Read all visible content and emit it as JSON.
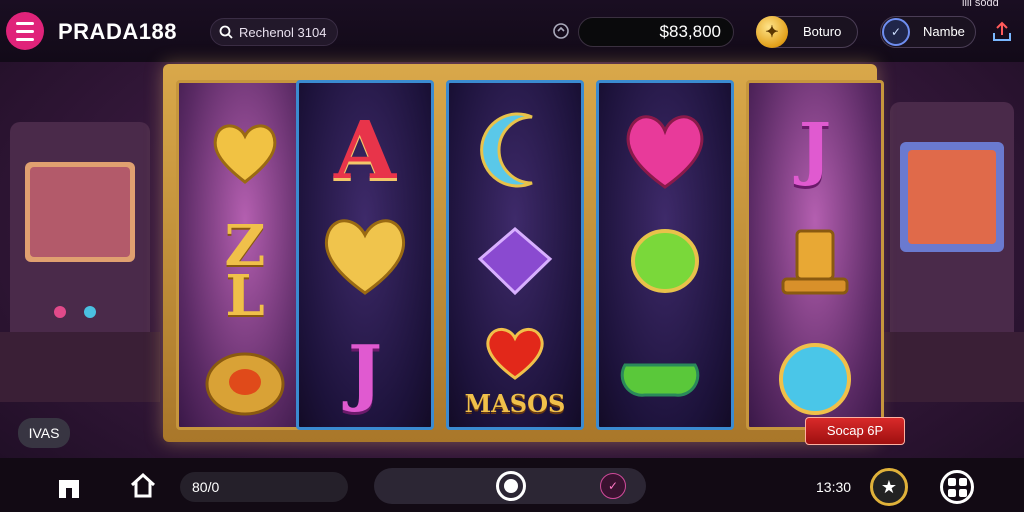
{
  "header": {
    "brand": "PRADA188",
    "search_text": "Rechenol 3104",
    "balance": "$83,800",
    "bonus_label": "Boturo",
    "mode_label": "Nambe",
    "corner_text": "ilil sodd",
    "icons": [
      "menu-icon",
      "search-icon",
      "wallet-icon",
      "coin-icon",
      "mode-icon",
      "share-icon"
    ]
  },
  "reels": [
    {
      "style": "gold",
      "symbols": [
        "gold-heart",
        "Z",
        "L",
        "ruby-ring"
      ]
    },
    {
      "style": "dark",
      "symbols": [
        "A",
        "gold-heart",
        "J"
      ]
    },
    {
      "style": "dark",
      "symbols": [
        "moon",
        "purple-pot",
        "heart",
        "MASOS"
      ]
    },
    {
      "style": "dark",
      "symbols": [
        "pink-heart",
        "green-gem",
        "green-teacup"
      ]
    },
    {
      "style": "gold",
      "symbols": [
        "J",
        "golden-hat",
        "blue-diamond"
      ]
    }
  ],
  "reel_letters": {
    "A": "A",
    "J": "J",
    "Z": "Z",
    "L": "L",
    "J2": "J",
    "masos": "MASOS"
  },
  "win_badge": "Socap 6P",
  "left_label": "IVAS",
  "bottom": {
    "bet_value": "80/0",
    "time": "13:30",
    "icons": [
      "store-icon",
      "home-icon",
      "spin-icon",
      "check-icon",
      "star-icon",
      "grid-icon"
    ]
  },
  "colors": {
    "accent": "#e0237a",
    "gold": "#d9a84a",
    "reel_border_blue": "#3b8bd0",
    "win": "#d92a2a"
  }
}
